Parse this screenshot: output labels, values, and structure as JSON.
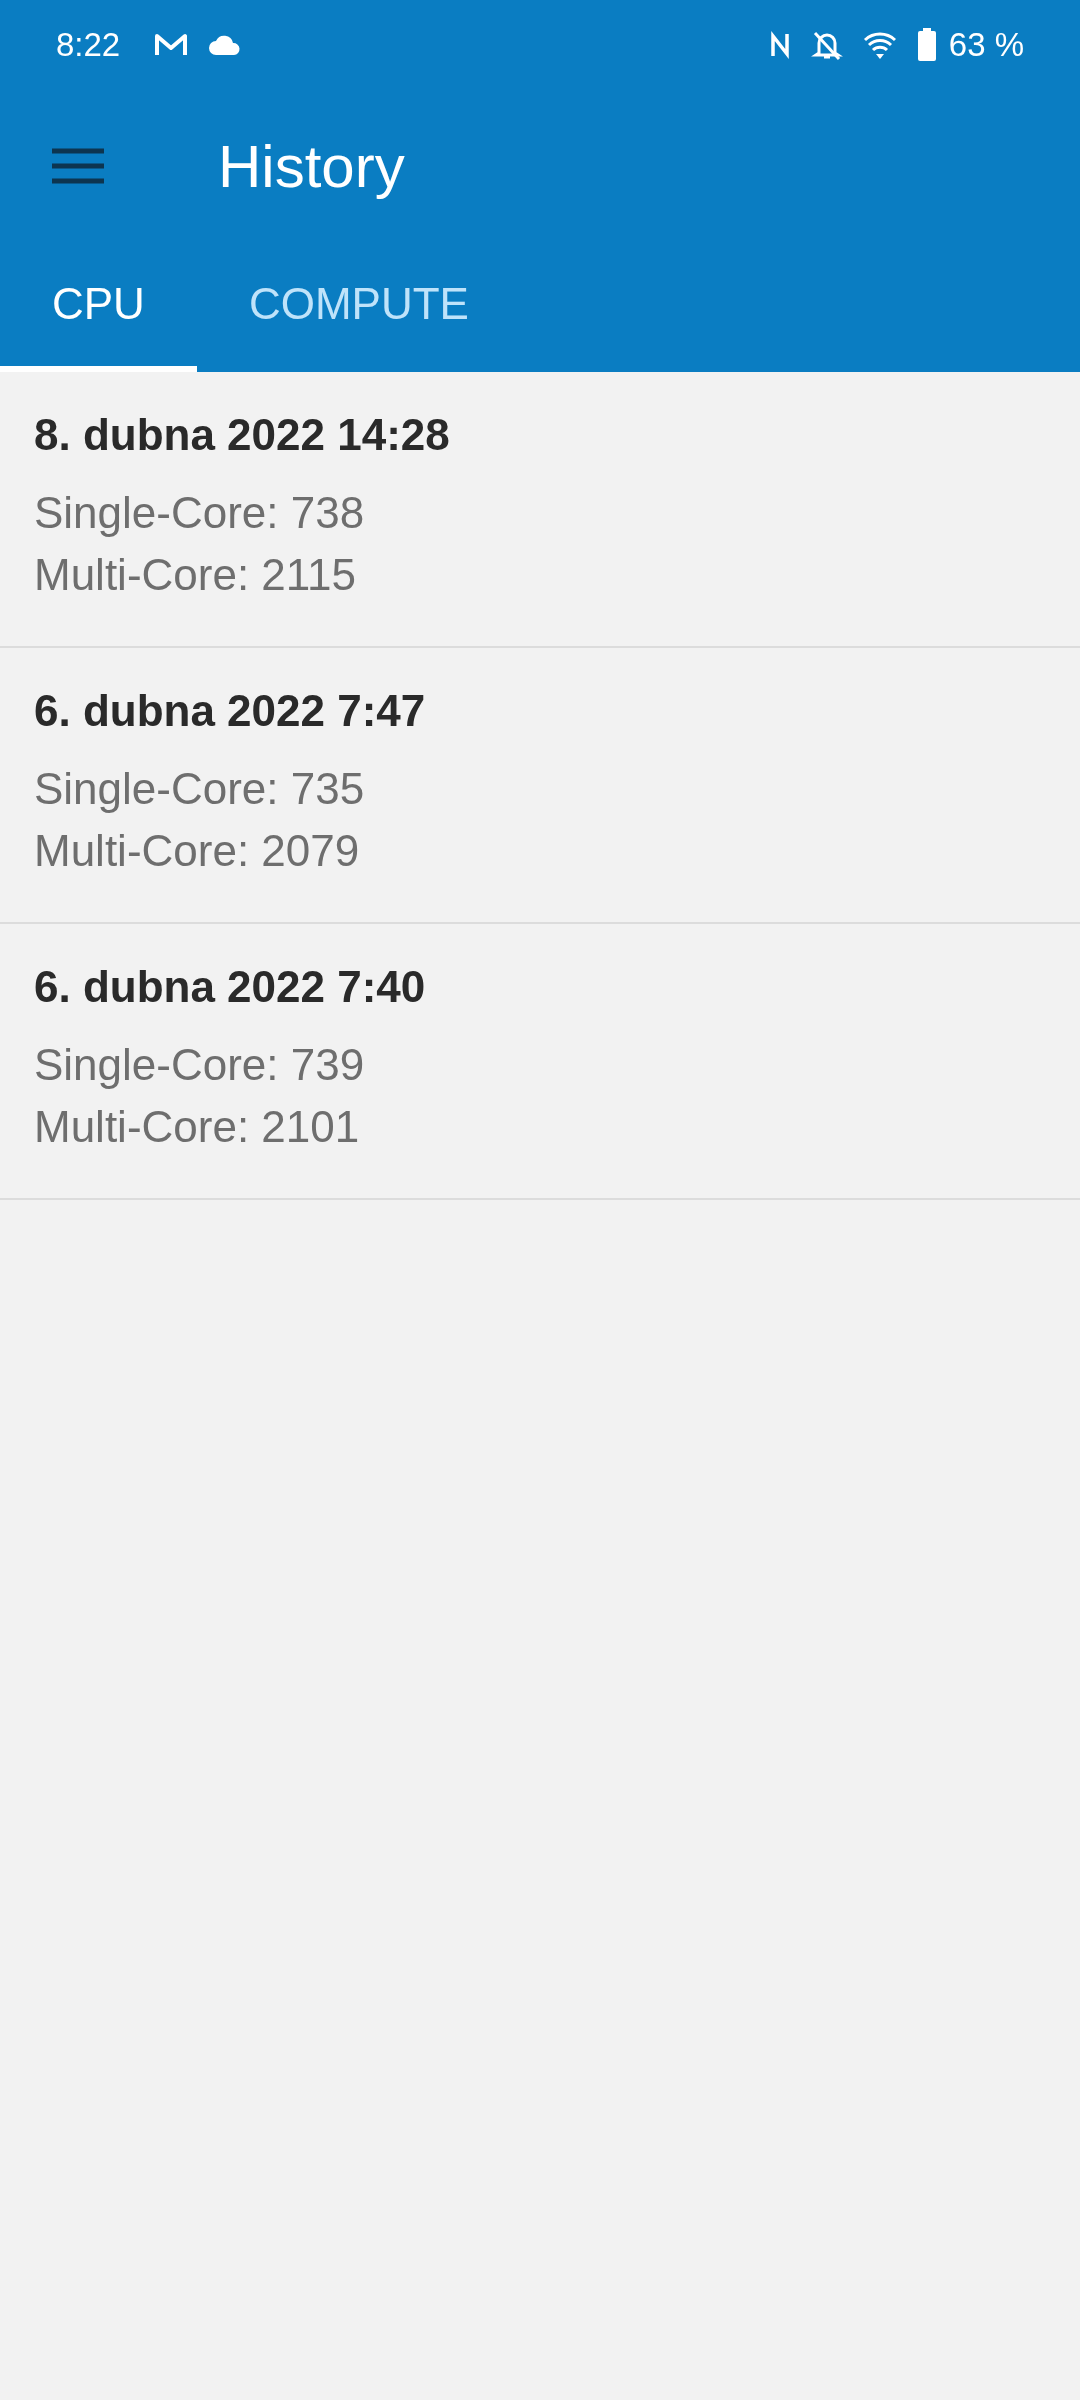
{
  "status_bar": {
    "time": "8:22",
    "battery_text": "63 %"
  },
  "app_bar": {
    "title": "History"
  },
  "tabs": [
    {
      "label": "CPU",
      "selected": true
    },
    {
      "label": "COMPUTE",
      "selected": false
    }
  ],
  "results": [
    {
      "date": "8. dubna 2022 14:28",
      "single_core": "Single-Core: 738",
      "multi_core": "Multi-Core: 2115"
    },
    {
      "date": "6. dubna 2022 7:47",
      "single_core": "Single-Core: 735",
      "multi_core": "Multi-Core: 2079"
    },
    {
      "date": "6. dubna 2022 7:40",
      "single_core": "Single-Core: 739",
      "multi_core": "Multi-Core: 2101"
    }
  ]
}
